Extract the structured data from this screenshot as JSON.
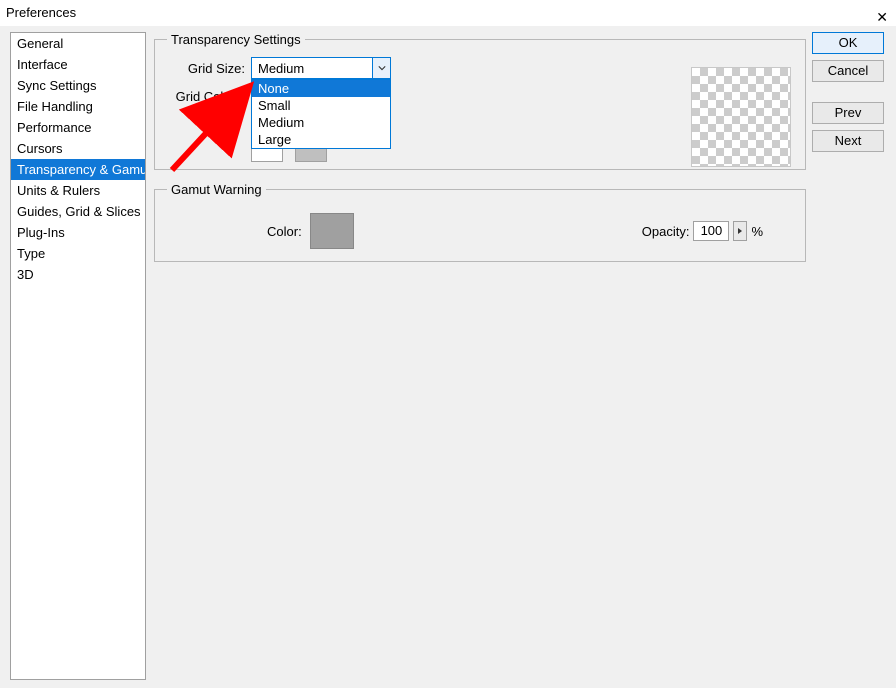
{
  "title": "Preferences",
  "sidebar": {
    "items": [
      {
        "label": "General"
      },
      {
        "label": "Interface"
      },
      {
        "label": "Sync Settings"
      },
      {
        "label": "File Handling"
      },
      {
        "label": "Performance"
      },
      {
        "label": "Cursors"
      },
      {
        "label": "Transparency & Gamut"
      },
      {
        "label": "Units & Rulers"
      },
      {
        "label": "Guides, Grid & Slices"
      },
      {
        "label": "Plug-Ins"
      },
      {
        "label": "Type"
      },
      {
        "label": "3D"
      }
    ],
    "selected_index": 6
  },
  "buttons": {
    "ok": "OK",
    "cancel": "Cancel",
    "prev": "Prev",
    "next": "Next"
  },
  "transparency": {
    "legend": "Transparency Settings",
    "grid_size_label": "Grid Size:",
    "grid_size_value": "Medium",
    "grid_size_options": [
      "None",
      "Small",
      "Medium",
      "Large"
    ],
    "grid_size_highlighted_index": 0,
    "grid_colors_label": "Grid Colors:"
  },
  "gamut": {
    "legend": "Gamut Warning",
    "color_label": "Color:",
    "opacity_label": "Opacity:",
    "opacity_value": "100",
    "opacity_unit": "%"
  }
}
